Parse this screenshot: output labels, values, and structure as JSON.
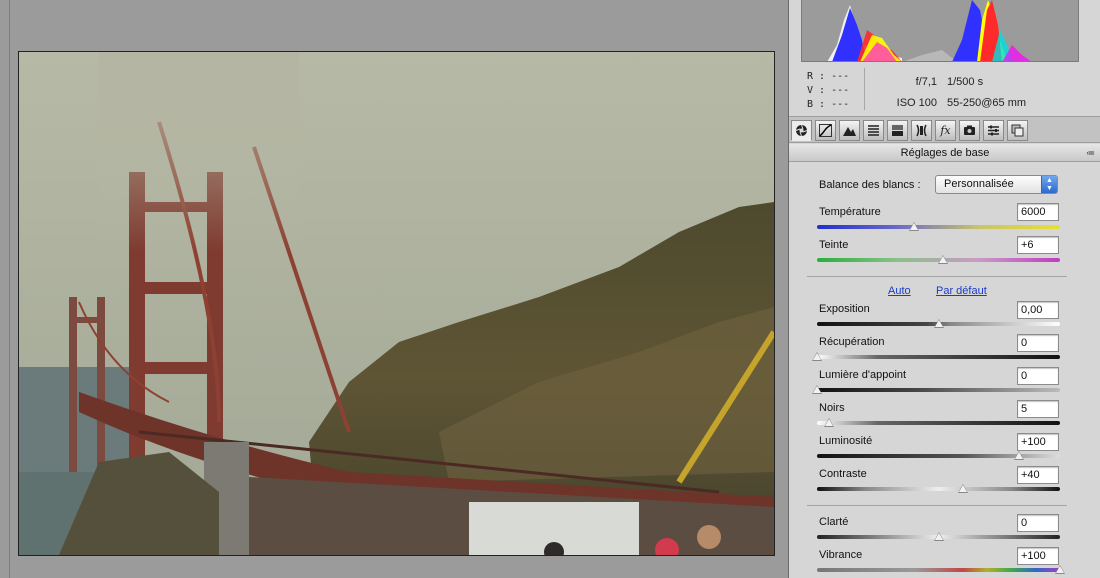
{
  "readout": {
    "r_label": "R :",
    "v_label": "V :",
    "b_label": "B :",
    "r_value": "---",
    "v_value": "---",
    "b_value": "---",
    "aperture": "f/7,1",
    "shutter": "1/500 s",
    "iso": "ISO 100",
    "lens": "55-250@65 mm"
  },
  "tool_tabs": [
    {
      "icon": "aperture-icon"
    },
    {
      "icon": "tone-curve-icon"
    },
    {
      "icon": "detail-icon"
    },
    {
      "icon": "hsl-icon"
    },
    {
      "icon": "split-toning-icon"
    },
    {
      "icon": "lens-corrections-icon"
    },
    {
      "icon": "effects-icon",
      "glyph": "fx"
    },
    {
      "icon": "camera-calibration-icon"
    },
    {
      "icon": "presets-icon"
    },
    {
      "icon": "snapshots-icon"
    }
  ],
  "panel": {
    "section_title": "Réglages de base",
    "wb_label": "Balance des blancs :",
    "wb_value": "Personnalisée",
    "auto_label": "Auto",
    "default_label": "Par défaut"
  },
  "controls": {
    "temperature": {
      "label": "Température",
      "value": "6000",
      "level": 0.4
    },
    "tint": {
      "label": "Teinte",
      "value": "+6",
      "level": 0.52
    },
    "exposure": {
      "label": "Exposition",
      "value": "0,00",
      "level": 0.5
    },
    "recovery": {
      "label": "Récupération",
      "value": "0",
      "level": 0.0
    },
    "fill_light": {
      "label": "Lumière d'appoint",
      "value": "0",
      "level": 0.0
    },
    "blacks": {
      "label": "Noirs",
      "value": "5",
      "level": 0.05
    },
    "brightness": {
      "label": "Luminosité",
      "value": "+100",
      "level": 0.83
    },
    "contrast": {
      "label": "Contraste",
      "value": "+40",
      "level": 0.6
    },
    "clarity": {
      "label": "Clarté",
      "value": "0",
      "level": 0.5
    },
    "vibrance": {
      "label": "Vibrance",
      "value": "+100",
      "level": 1.0
    }
  },
  "colors": {
    "panel_bg": "#d6d6d6",
    "temperature_gradient": [
      "#1f2fd0",
      "#e6e032"
    ],
    "tint_gradient": [
      "#23b23a",
      "#c23bc2"
    ],
    "link": "#1a3cc9"
  }
}
